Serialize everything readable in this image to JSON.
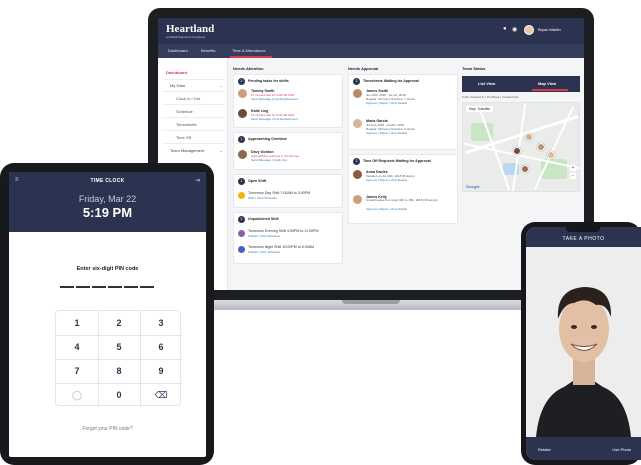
{
  "laptop": {
    "brand": "Heartland",
    "brand_sub": "a Global Payments Company",
    "user_name": "Bryan Martin",
    "nav": [
      "Dashboard",
      "Benefits",
      "Time & Attendance"
    ],
    "sidebar": {
      "heading": "Dashboard",
      "items": [
        "My Data",
        "Clock In / Out",
        "Schedule",
        "Timesheets",
        "Time Off",
        "Team Management"
      ]
    },
    "needs_attention": {
      "title": "Needs Attention",
      "pending_shifts": {
        "count": "2",
        "heading": "Pending tasks for shifts",
        "rows": [
          {
            "name": "Tommy Smith",
            "line1": "11 minutes late for 9:00 AM Shift",
            "line2": "Send Message | Find Replacement"
          },
          {
            "name": "Katie Ling",
            "line1": "11 minutes late for 9:00 AM Shift",
            "line2": "Send Message | Find Replacement"
          }
        ]
      },
      "overtime": {
        "count": "1",
        "heading": "Approaching Overtime",
        "rows": [
          {
            "name": "Davy Gordon",
            "line1": "Approaching overtime in 30 minutes",
            "line2": "Send Message | Clock Out"
          }
        ]
      },
      "open_shift": {
        "count": "1",
        "heading": "Open Shift",
        "rows": [
          {
            "name": "Tomorrow Day Shift 7:00AM to 3:00PM",
            "line1": "",
            "line2": "Offer | View Schedule"
          }
        ]
      },
      "unpublished": {
        "count": "2",
        "heading": "Unpublished Shift",
        "rows": [
          {
            "name": "Tomorrow Evening Shift 4:00PM to 11:00PM",
            "line1": "",
            "line2": "Publish | View Schedule"
          },
          {
            "name": "Tomorrow Night Shift 10:00PM to 6:30AM",
            "line1": "",
            "line2": "Publish | View Schedule"
          }
        ]
      }
    },
    "needs_approval": {
      "title": "Needs Approval",
      "timesheets": {
        "count": "2",
        "heading": "Timesheets Waiting for Approval",
        "rows": [
          {
            "name": "James Smith",
            "line1": "Jun 25th, 2018 - Jul 1st, 2018",
            "line2": "Approve | Reject | View Details",
            "line3": "Regular: 40 hours Overtime: 7 Hours"
          },
          {
            "name": "Maria Garcia",
            "line1": "Jul 2nd, 2018 - Jul 8th, 2018",
            "line2": "Approve | Reject | View Details",
            "line3": "Regular: 30 hours Overtime: 0 Hours"
          }
        ]
      },
      "timeoff": {
        "count": "2",
        "heading": "Time Off Requests Waiting for Approval",
        "rows": [
          {
            "name": "Anna Davies",
            "line1": "Vacation on Jul 19th, 2018 (8 Hours)",
            "line2": "Approve | Reject | View Details"
          },
          {
            "name": "James Kelly",
            "line1": "Unpaid Leave from Aug 13th to 15th, 2018 (30 Hours)",
            "line2": "Approve | Reject | View Details"
          }
        ]
      }
    },
    "team_status": {
      "title": "Team Status",
      "tabs": [
        "List View",
        "Map View"
      ],
      "filter": "3 All | Clocked In | On Break | Clocked Out",
      "map_controls": [
        "Map",
        "Satellite"
      ],
      "map_provider": "Google"
    }
  },
  "tablet": {
    "title": "TIME CLOCK",
    "date": "Friday, Mar 22",
    "time": "5:19 PM",
    "prompt": "Enter six-digit PIN code",
    "keys": [
      "1",
      "2",
      "3",
      "4",
      "5",
      "6",
      "7",
      "8",
      "9",
      "",
      "0",
      "⌫"
    ],
    "forgot": "Forgot your PIN code?"
  },
  "phone": {
    "title": "TAKE A PHOTO",
    "retake": "Retake",
    "use": "Use Photo"
  },
  "colors": {
    "navy": "#2b3350",
    "accent_red": "#d93a48",
    "link_blue": "#2a7bb8"
  }
}
